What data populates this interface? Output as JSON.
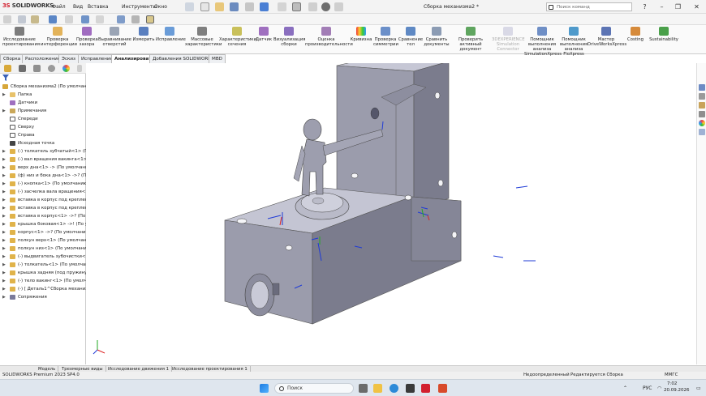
{
  "app": {
    "name": "SOLIDWORKS",
    "brand_color": "#d2202f"
  },
  "menu": [
    "Файл",
    "Вид",
    "Вставка",
    "Инструменты",
    "Окно"
  ],
  "document_title": "Сборка механизма2 *",
  "search": {
    "placeholder": "Поиск команд"
  },
  "ribbon": [
    {
      "label": "Исследование\nпроектирования",
      "icon": "study-icon",
      "enabled": true
    },
    {
      "label": "Проверка\nинтерференции",
      "icon": "interference-icon",
      "enabled": true
    },
    {
      "label": "Проверка\nзазора",
      "icon": "clearance-icon",
      "enabled": true
    },
    {
      "label": "Выравнивание\nотверстий",
      "icon": "hole-align-icon",
      "enabled": true
    },
    {
      "label": "Измерить",
      "icon": "measure-icon",
      "enabled": true
    },
    {
      "label": "Исправление",
      "icon": "fix-icon",
      "enabled": true
    },
    {
      "label": "Массовые\nхарактеристики",
      "icon": "mass-icon",
      "enabled": true
    },
    {
      "label": "Характеристики\nсечения",
      "icon": "section-icon",
      "enabled": true
    },
    {
      "label": "Датчик",
      "icon": "sensor-icon",
      "enabled": true
    },
    {
      "label": "Визуализация\nсборки",
      "icon": "visualize-icon",
      "enabled": true
    },
    {
      "label": "Оценка\nпроизводительности",
      "icon": "performance-icon",
      "enabled": true
    },
    {
      "label": "Кривизна",
      "icon": "curvature-icon",
      "enabled": true
    },
    {
      "label": "Проверка\nсимметрии",
      "icon": "symmetry-icon",
      "enabled": true
    },
    {
      "label": "Сравнение\nтел",
      "icon": "compare-bodies-icon",
      "enabled": true
    },
    {
      "label": "Сравнить\nдокументы",
      "icon": "compare-docs-icon",
      "enabled": true
    },
    {
      "label": "Проверить\nактивный документ",
      "icon": "check-doc-icon",
      "enabled": true
    },
    {
      "label": "3DEXPERIENCE\nSimulation\nConnector",
      "icon": "3dx-icon",
      "enabled": false
    },
    {
      "label": "Помощник\nвыполнения\nанализа\nSimulationXpress",
      "icon": "simxpress-icon",
      "enabled": true
    },
    {
      "label": "Помощник\nвыполнения\nанализа\nFloXpress",
      "icon": "floxpress-icon",
      "enabled": true
    },
    {
      "label": "Мастер\nDriveWorksXpress",
      "icon": "driveworks-icon",
      "enabled": true
    },
    {
      "label": "Costing",
      "icon": "costing-icon",
      "enabled": true
    },
    {
      "label": "Sustainability",
      "icon": "sustainability-icon",
      "enabled": true
    }
  ],
  "tabs": [
    "Сборка",
    "Расположение",
    "Эскиз",
    "Исправление",
    "Анализировать",
    "Добавления SOLIDWORKS",
    "MBD"
  ],
  "active_tab": "Анализировать",
  "tree": [
    {
      "label": "Сборка механизма2 (По умолчани...",
      "icon": "assembly-icon",
      "expand": "",
      "indent": 0
    },
    {
      "label": "Папка",
      "icon": "folder-icon",
      "expand": "▶",
      "indent": 1
    },
    {
      "label": "Датчики",
      "icon": "sensor-icon",
      "expand": "",
      "indent": 1
    },
    {
      "label": "Примечания",
      "icon": "annotation-icon",
      "expand": "▶",
      "indent": 1
    },
    {
      "label": "Спереди",
      "icon": "plane-icon",
      "expand": "",
      "indent": 1
    },
    {
      "label": "Сверху",
      "icon": "plane-icon",
      "expand": "",
      "indent": 1
    },
    {
      "label": "Справа",
      "icon": "plane-icon",
      "expand": "",
      "indent": 1
    },
    {
      "label": "Исходная точка",
      "icon": "origin-icon",
      "expand": "",
      "indent": 1
    },
    {
      "label": "(-) толкатель зубчатый<1> (По у...",
      "icon": "part-icon",
      "expand": "▶",
      "indent": 1
    },
    {
      "label": "(-) вал вращения вакинга<1> (П...",
      "icon": "part-icon",
      "expand": "▶",
      "indent": 1
    },
    {
      "label": "верх дна<1> -> (По умолчанию...",
      "icon": "part-icon",
      "expand": "▶",
      "indent": 1
    },
    {
      "label": "(ф) низ и бока дна<1> ->? (По у...",
      "icon": "part-icon",
      "expand": "▶",
      "indent": 1
    },
    {
      "label": "(-) кнопка<1> (По умолчанию)...",
      "icon": "part-icon",
      "expand": "▶",
      "indent": 1
    },
    {
      "label": "(-) засчелка вала вращения<1>...",
      "icon": "part-icon",
      "expand": "▶",
      "indent": 1
    },
    {
      "label": "вставка в корпус под крепление...",
      "icon": "part-icon",
      "expand": "▶",
      "indent": 1
    },
    {
      "label": "вставка в корпус под крепление...",
      "icon": "part-icon",
      "expand": "▶",
      "indent": 1
    },
    {
      "label": "вставка в корпус<1> ->? (По ум...",
      "icon": "part-icon",
      "expand": "▶",
      "indent": 1
    },
    {
      "label": "крышка боковая<1> ->! (По ум...",
      "icon": "part-icon",
      "expand": "▶",
      "indent": 1
    },
    {
      "label": "корпус<1> ->? (По умолчанию)...",
      "icon": "part-icon",
      "expand": "▶",
      "indent": 1
    },
    {
      "label": "полкун верх<1> (По умолчанию...",
      "icon": "part-icon",
      "expand": "▶",
      "indent": 1
    },
    {
      "label": "полкун низ<1> (По умолчанию)...",
      "icon": "part-icon",
      "expand": "▶",
      "indent": 1
    },
    {
      "label": "(-) выдвигатель зубочистки<1>...",
      "icon": "part-icon",
      "expand": "▶",
      "indent": 1
    },
    {
      "label": "(-) толкатель<1> (По умолчани...",
      "icon": "part-icon",
      "expand": "▶",
      "indent": 1
    },
    {
      "label": "крышка задняя (под пружину<1...",
      "icon": "part-icon",
      "expand": "▶",
      "indent": 1
    },
    {
      "label": "(-) тело вакинг<1> (По умолчан...",
      "icon": "part-icon",
      "expand": "▶",
      "indent": 1
    },
    {
      "label": "(-) [ Деталь1^Сборка механизм...",
      "icon": "part-icon",
      "expand": "▶",
      "indent": 1
    },
    {
      "label": "Сопряжения",
      "icon": "mates-icon",
      "expand": "▶",
      "indent": 1
    }
  ],
  "bottom_tabs": [
    "Модель",
    "Трехмерные виды",
    "Исследование движения 1",
    "Исследование проектирования 1"
  ],
  "active_bottom_tab": "Модель",
  "status": {
    "left": "SOLIDWORKS Premium 2023 SP4.0",
    "def": "Недоопределенный",
    "edit": "Редактируется Сборка",
    "units": "MMГС"
  },
  "taskbar": {
    "search_placeholder": "Поиск",
    "lang": "РУС",
    "time": "7:02",
    "date": "20.09.2026"
  },
  "colors": {
    "model": "#9b9cac",
    "model_dark": "#6e6f80",
    "model_light": "#c4c5d3",
    "triad_blue": "#1f3bd6"
  }
}
